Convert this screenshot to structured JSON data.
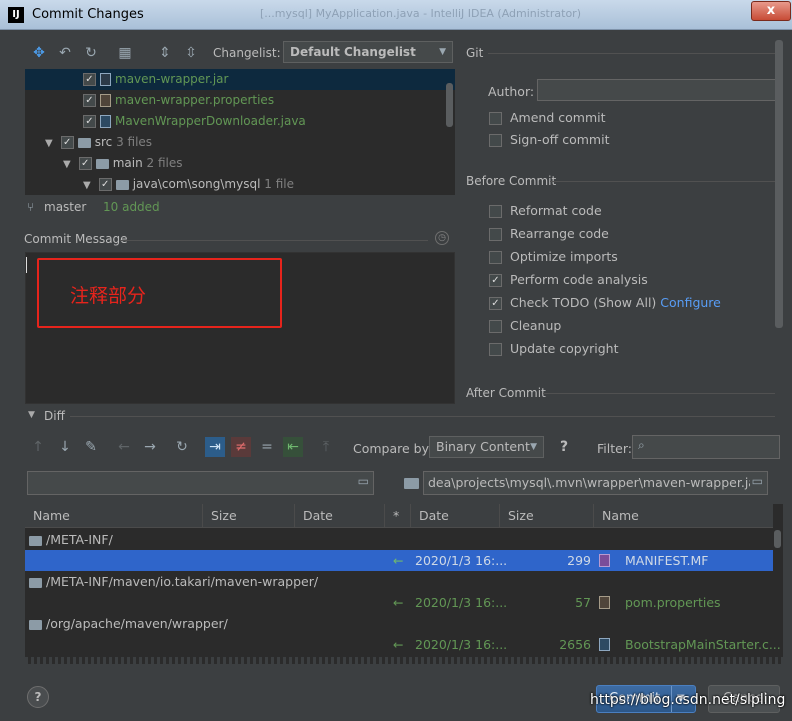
{
  "window": {
    "title": "Commit Changes",
    "app_icon": "IJ",
    "background_title": "[...mysql] MyApplication.java - IntelliJ IDEA (Administrator)",
    "close_label": "x"
  },
  "toolbar": {
    "changelist_label": "Changelist:",
    "changelist_value": "Default Changelist"
  },
  "tree": {
    "rows": [
      {
        "name": "maven-wrapper.jar",
        "extra": "",
        "color": "green",
        "kind": "jar"
      },
      {
        "name": "maven-wrapper.properties",
        "extra": "",
        "color": "green",
        "kind": "props"
      },
      {
        "name": "MavenWrapperDownloader.java",
        "extra": "",
        "color": "green",
        "kind": "java"
      },
      {
        "name": "src",
        "extra": "3 files",
        "color": "normal",
        "kind": "folder"
      },
      {
        "name": "main",
        "extra": "2 files",
        "color": "normal",
        "kind": "folder"
      },
      {
        "name": "java\\com\\song\\mysql",
        "extra": "1 file",
        "color": "normal",
        "kind": "folder"
      }
    ]
  },
  "status": {
    "branch": "master",
    "added": "10 added"
  },
  "commit_message": {
    "label": "Commit Message",
    "annotation": "注释部分"
  },
  "git": {
    "section": "Git",
    "author_label": "Author:",
    "author_value": "",
    "amend_commit": "Amend commit",
    "signoff_commit": "Sign-off commit"
  },
  "before_commit": {
    "section": "Before Commit",
    "options": [
      {
        "label": "Reformat code",
        "checked": false
      },
      {
        "label": "Rearrange code",
        "checked": false
      },
      {
        "label": "Optimize imports",
        "checked": false
      },
      {
        "label": "Perform code analysis",
        "checked": true
      },
      {
        "label": "Check TODO (Show All)",
        "checked": true,
        "link": "Configure"
      },
      {
        "label": "Cleanup",
        "checked": false
      },
      {
        "label": "Update copyright",
        "checked": false
      }
    ]
  },
  "after_commit": {
    "section": "After Commit"
  },
  "diff": {
    "section": "Diff",
    "compare_by_label": "Compare by:",
    "compare_by_value": "Binary Content",
    "help": "?",
    "filter_label": "Filter:",
    "left_path": "",
    "right_path": "dea\\projects\\mysql\\.mvn\\wrapper\\maven-wrapper.jar",
    "columns_left": [
      "Name",
      "Size",
      "Date"
    ],
    "star": "*",
    "columns_right": [
      "Date",
      "Size",
      "Name"
    ],
    "rows": [
      {
        "type": "dir",
        "name": "/META-INF/"
      },
      {
        "type": "file",
        "arrow": "←",
        "date": "2020/1/3 16:...",
        "size": "299",
        "name": "MANIFEST.MF",
        "selected": true
      },
      {
        "type": "dir",
        "name": "/META-INF/maven/io.takari/maven-wrapper/"
      },
      {
        "type": "file",
        "arrow": "←",
        "date": "2020/1/3 16:...",
        "size": "57",
        "name": "pom.properties",
        "selected": false
      },
      {
        "type": "dir",
        "name": "/org/apache/maven/wrapper/"
      },
      {
        "type": "file",
        "arrow": "←",
        "date": "2020/1/3 16:...",
        "size": "2656",
        "name": "BootstrapMainStarter.c...",
        "selected": false
      }
    ]
  },
  "footer": {
    "help": "?",
    "commit": "Commit",
    "cancel": "Cancel",
    "watermark": "https://blog.csdn.net/slpling"
  }
}
